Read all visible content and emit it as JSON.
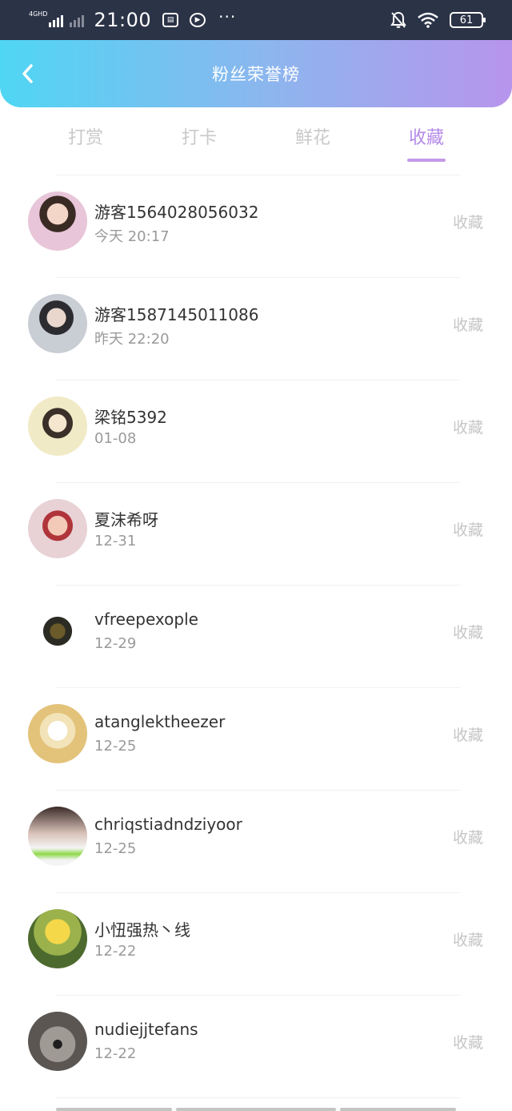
{
  "status_bar": {
    "network": "4GHD",
    "time": "21:00",
    "battery": "61",
    "icons": [
      "signal-icon",
      "sim-icon",
      "video-icon",
      "more-icon",
      "mute-icon",
      "wifi-icon",
      "battery-icon"
    ],
    "more": "···"
  },
  "header": {
    "title": "粉丝荣誉榜",
    "back_icon": "chevron-left-icon",
    "gradient": [
      "#4fd6f3",
      "#b795ec"
    ]
  },
  "tabs": [
    {
      "label": "打赏",
      "active": false
    },
    {
      "label": "打卡",
      "active": false
    },
    {
      "label": "鲜花",
      "active": false
    },
    {
      "label": "收藏",
      "active": true
    }
  ],
  "accent_color": "#b58ae7",
  "list": [
    {
      "name": "游客1564028056032",
      "date": "今天 20:17",
      "action": "收藏"
    },
    {
      "name": "游客1587145011086",
      "date": "昨天 22:20",
      "action": "收藏"
    },
    {
      "name": "梁铭5392",
      "date": "01-08",
      "action": "收藏"
    },
    {
      "name": "夏沫希呀",
      "date": "12-31",
      "action": "收藏"
    },
    {
      "name": "vfreepexople",
      "date": "12-29",
      "action": "收藏"
    },
    {
      "name": "atanglektheezer",
      "date": "12-25",
      "action": "收藏"
    },
    {
      "name": "chriqstiadndziyoor",
      "date": "12-25",
      "action": "收藏"
    },
    {
      "name": "小忸强热丶线",
      "date": "12-22",
      "action": "收藏"
    },
    {
      "name": "nudiejjtefans",
      "date": "12-22",
      "action": "收藏"
    }
  ]
}
